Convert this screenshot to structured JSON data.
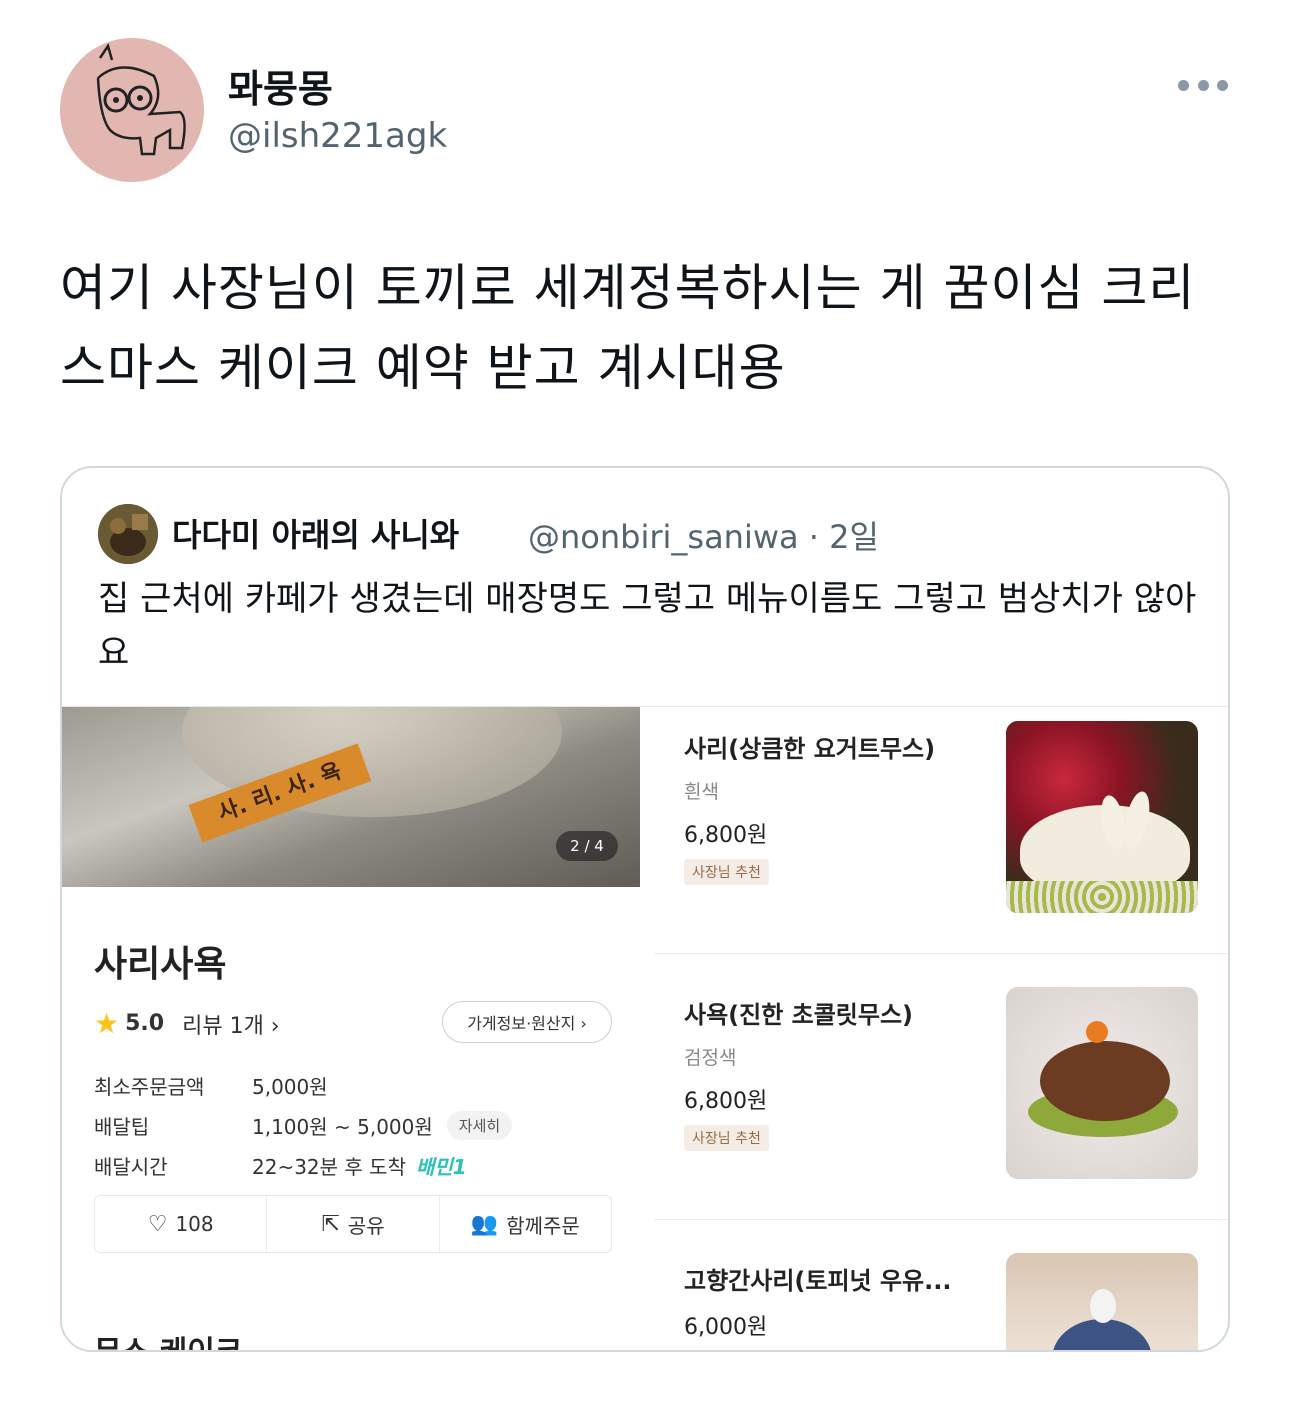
{
  "tweet": {
    "display_name": "뫄뭉몽",
    "handle": "@ilsh221agk",
    "text": "여기 사장님이 토끼로 세계정복하시는 게 꿈이심 크리스마스 케이크 예약 받고 계시대용",
    "more_icon": "ellipsis-icon"
  },
  "quoted": {
    "display_name": "다다미 아래의 사니와",
    "meta": "@nonbiri_saniwa · 2일",
    "text": "집 근처에 카페가 생겼는데 매장명도 그렇고 메뉴이름도 그렇고 범상치가 않아요"
  },
  "screenshot": {
    "photo_sticker": "사. 리. 사. 욕",
    "pager": "2 / 4",
    "store_name": "사리사욕",
    "rating": "5.0",
    "reviews": "리뷰 1개 ›",
    "store_info_btn": "가게정보·원산지 ›",
    "info": [
      {
        "k": "최소주문금액",
        "v": "5,000원"
      },
      {
        "k": "배달팁",
        "v": "1,100원 ~ 5,000원",
        "extra": "자세히"
      },
      {
        "k": "배달시간",
        "v": "22~32분 후 도착",
        "extra": "배민1"
      }
    ],
    "actions": {
      "like": "108",
      "share": "공유",
      "group": "함께주문"
    },
    "category": "무스 케이크",
    "menu": [
      {
        "name": "사리(상큼한 요거트무스)",
        "desc": "흰색",
        "price": "6,800원",
        "badge": "사장님 추천"
      },
      {
        "name": "사욕(진한 초콜릿무스)",
        "desc": "검정색",
        "price": "6,800원",
        "badge": "사장님 추천"
      },
      {
        "name": "고향간사리(토피넛 우유...",
        "price": "6,000원"
      }
    ]
  },
  "colors": {
    "text": "#0f1419",
    "secondary": "#536471",
    "border": "#cfd9de",
    "star": "#ffc21a",
    "baemin": "#2ac1bc"
  }
}
